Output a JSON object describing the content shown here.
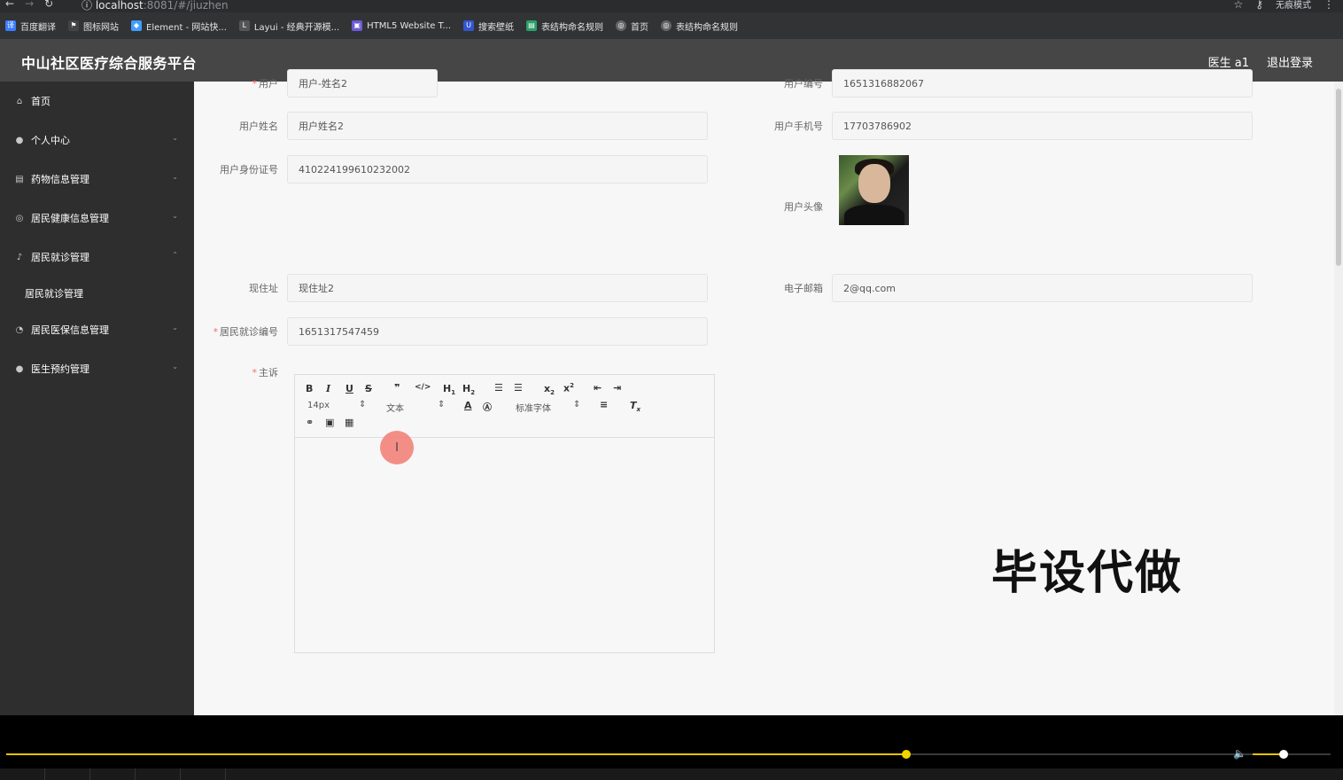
{
  "browser": {
    "url_host": "localhost",
    "url_path": ":8081/#/jiuzhen",
    "mode_label": "无痕模式"
  },
  "bookmarks": [
    {
      "label": "百度翻译",
      "color": "#3b7cff"
    },
    {
      "label": "图标网站",
      "color": "#444"
    },
    {
      "label": "Element - 网站快...",
      "color": "#409eff"
    },
    {
      "label": "Layui - 经典开源模...",
      "color": "#555"
    },
    {
      "label": "HTML5 Website T...",
      "color": "#6b5bd6"
    },
    {
      "label": "搜索壁纸",
      "color": "#3355cc"
    },
    {
      "label": "表结构命名规则",
      "color": "#2aa06a"
    },
    {
      "label": "首页",
      "color": "#666"
    },
    {
      "label": "表结构命名规则",
      "color": "#666"
    }
  ],
  "header": {
    "brand": "中山社区医疗综合服务平台",
    "user": "医生 a1",
    "logout": "退出登录"
  },
  "sidebar": {
    "items": [
      {
        "label": "首页",
        "icon": "home-icon"
      },
      {
        "label": "个人中心",
        "icon": "user-icon"
      },
      {
        "label": "药物信息管理",
        "icon": "document-icon"
      },
      {
        "label": "居民健康信息管理",
        "icon": "circle-icon"
      },
      {
        "label": "居民就诊管理",
        "icon": "microphone-icon"
      },
      {
        "label": "居民就诊管理"
      },
      {
        "label": "居民医保信息管理",
        "icon": "gauge-icon"
      },
      {
        "label": "医生预约管理",
        "icon": "user-icon"
      }
    ]
  },
  "form": {
    "user_account": {
      "label": "用户",
      "value": "用户-姓名2"
    },
    "user_no": {
      "label": "用户编号",
      "value": "1651316882067"
    },
    "user_name": {
      "label": "用户姓名",
      "value": "用户姓名2"
    },
    "user_phone": {
      "label": "用户手机号",
      "value": "17703786902"
    },
    "user_idcard": {
      "label": "用户身份证号",
      "value": "410224199610232002"
    },
    "user_avatar": {
      "label": "用户头像"
    },
    "address": {
      "label": "现住址",
      "value": "现住址2"
    },
    "email": {
      "label": "电子邮箱",
      "value": "2@qq.com"
    },
    "visit_no": {
      "label": "居民就诊编号",
      "value": "1651317547459"
    },
    "complaint": {
      "label": "主诉"
    }
  },
  "editor": {
    "font_size": "14px",
    "text_style": "文本",
    "font_family": "标准字体"
  },
  "watermark": "毕设代做",
  "player": {
    "progress_fraction": 0.68,
    "volume_fraction": 0.4
  }
}
